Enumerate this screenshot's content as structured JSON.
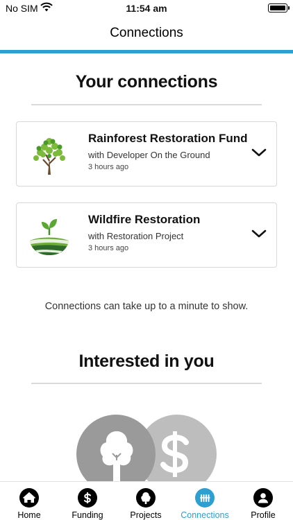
{
  "status_bar": {
    "carrier": "No SIM",
    "time": "11:54 am"
  },
  "header": {
    "title": "Connections"
  },
  "connections_section": {
    "title": "Your connections"
  },
  "connections": [
    {
      "title": "Rainforest Restoration Fund",
      "subtitle": "with Developer On the Ground",
      "time": "3 hours ago",
      "logo": "tree-logo-icon"
    },
    {
      "title": "Wildfire Restoration",
      "subtitle": "with Restoration Project",
      "time": "3 hours ago",
      "logo": "sprout-field-logo-icon"
    }
  ],
  "hint": "Connections can take up to a minute to show.",
  "interested_section": {
    "title": "Interested in you"
  },
  "tabs": [
    {
      "label": "Home",
      "icon": "home-icon"
    },
    {
      "label": "Funding",
      "icon": "dollar-icon"
    },
    {
      "label": "Projects",
      "icon": "tree-icon"
    },
    {
      "label": "Connections",
      "icon": "connections-icon",
      "active": true
    },
    {
      "label": "Profile",
      "icon": "person-icon"
    }
  ],
  "colors": {
    "accent": "#2e9fd1",
    "tab_active": "#2e9fd1"
  }
}
